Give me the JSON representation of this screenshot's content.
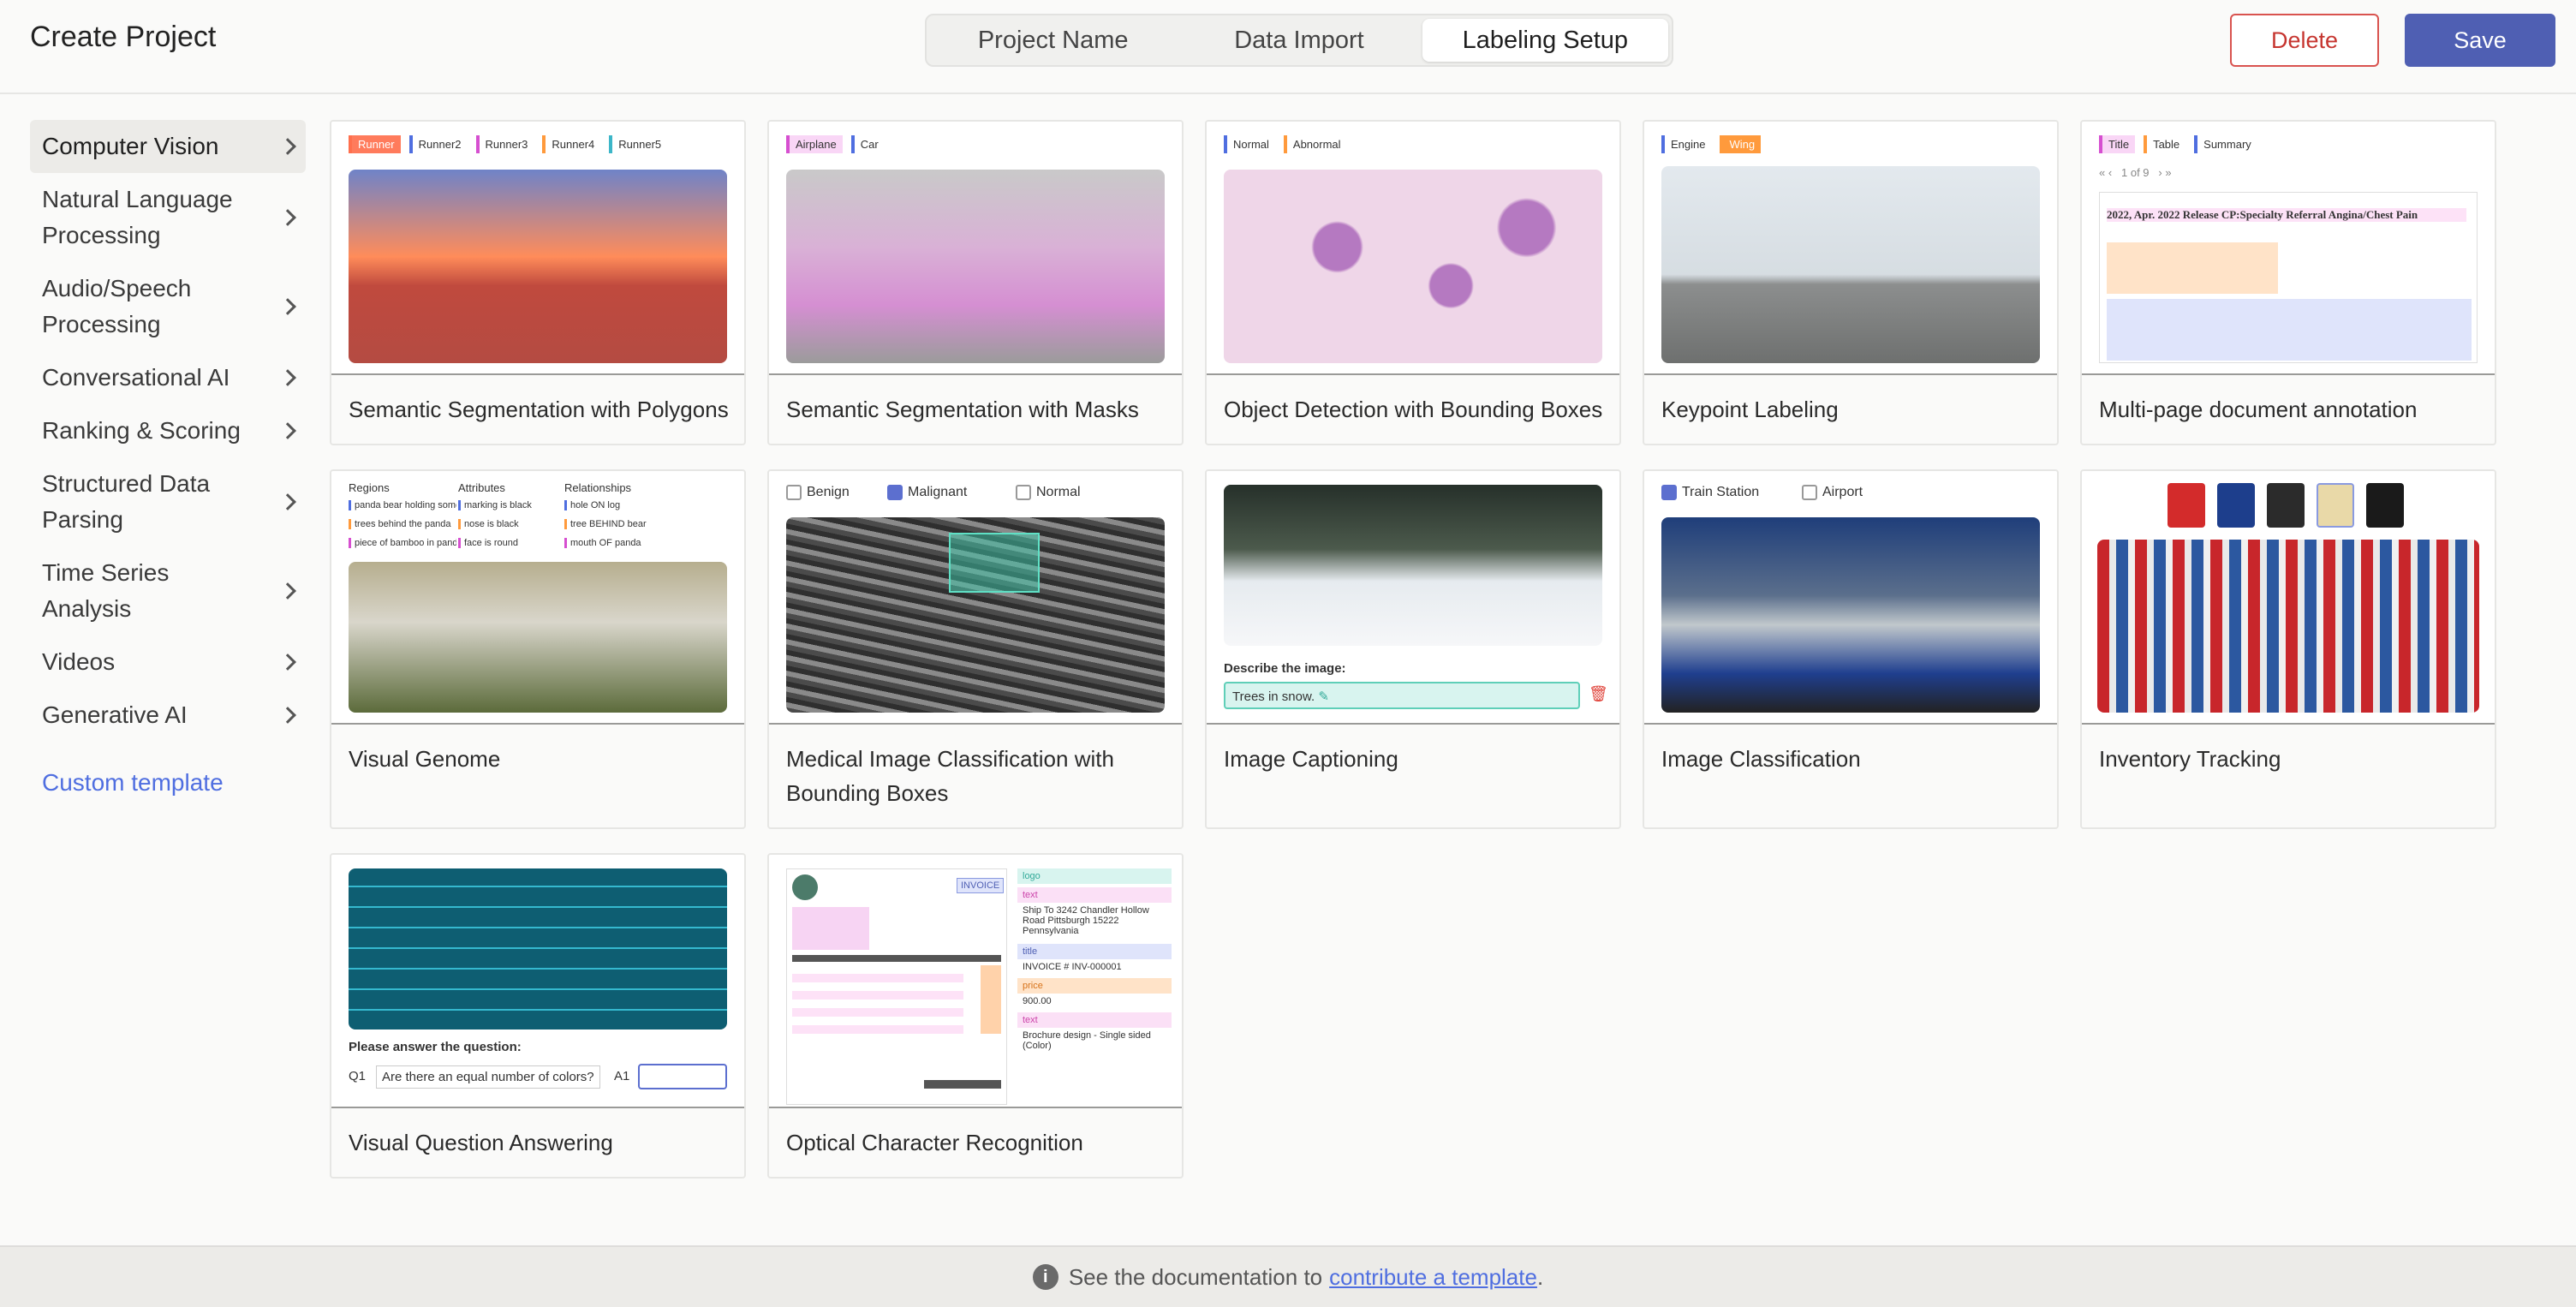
{
  "header": {
    "title": "Create Project",
    "tabs": [
      "Project Name",
      "Data Import",
      "Labeling Setup"
    ],
    "active_tab": "Labeling Setup",
    "delete_label": "Delete",
    "save_label": "Save"
  },
  "sidebar": {
    "items": [
      {
        "label": "Computer Vision",
        "active": true
      },
      {
        "label": "Natural Language Processing"
      },
      {
        "label": "Audio/Speech Processing"
      },
      {
        "label": "Conversational AI"
      },
      {
        "label": "Ranking & Scoring"
      },
      {
        "label": "Structured Data Parsing"
      },
      {
        "label": "Time Series Analysis"
      },
      {
        "label": "Videos"
      },
      {
        "label": "Generative AI"
      }
    ],
    "custom_template": "Custom template"
  },
  "cards": [
    {
      "title": "Semantic Segmentation with Polygons",
      "chips": [
        "Runner",
        "Runner2",
        "Runner3",
        "Runner4",
        "Runner5"
      ]
    },
    {
      "title": "Semantic Segmentation with Masks",
      "chips": [
        "Airplane",
        "Car"
      ]
    },
    {
      "title": "Object Detection with Bounding Boxes",
      "chips": [
        "Normal",
        "Abnormal"
      ]
    },
    {
      "title": "Keypoint Labeling",
      "chips": [
        "Engine",
        "Wing"
      ]
    },
    {
      "title": "Multi-page document annotation",
      "chips": [
        "Title",
        "Table",
        "Summary"
      ],
      "pager": "1 of 9",
      "doc_heading": "2022, Apr. 2022 Release CP:Specialty Referral Angina/Chest Pain"
    },
    {
      "title": "Visual Genome",
      "columns": [
        "Regions",
        "Attributes",
        "Relationships"
      ],
      "regions": [
        "panda bear holding something",
        "trees behind the panda",
        "piece of bamboo in panda's paw"
      ],
      "attributes": [
        "marking is black",
        "nose is black",
        "face is round"
      ],
      "relationships": [
        "hole ON log",
        "tree BEHIND bear",
        "mouth OF panda"
      ]
    },
    {
      "title": "Medical Image Classification with Bounding Boxes",
      "options": [
        "Benign",
        "Malignant",
        "Normal"
      ],
      "checked": "Malignant"
    },
    {
      "title": "Image Captioning",
      "prompt": "Describe the image:",
      "caption": "Trees in snow."
    },
    {
      "title": "Image Classification",
      "options": [
        "Train Station",
        "Airport"
      ],
      "checked": "Train Station"
    },
    {
      "title": "Inventory Tracking"
    },
    {
      "title": "Visual Question Answering",
      "prompt": "Please answer the question:",
      "q_label": "Q1",
      "question": "Are there an equal number of colors?",
      "a_label": "A1"
    },
    {
      "title": "Optical Character Recognition",
      "fields": [
        "logo",
        "text",
        "title",
        "price",
        "text"
      ],
      "values": [
        "Ship To 3242 Chandler Hollow Road Pittsburgh 15222 Pennsylvania",
        "INVOICE # INV-000001",
        "900.00",
        "Brochure design - Single sided (Color)"
      ],
      "invoice_label": "INVOICE"
    }
  ],
  "footer": {
    "text": "See the documentation to",
    "link": "contribute a template",
    "period": "."
  },
  "colors": {
    "accent": "#4f5fb3",
    "link": "#4f6ee0",
    "danger": "#c6352f"
  }
}
